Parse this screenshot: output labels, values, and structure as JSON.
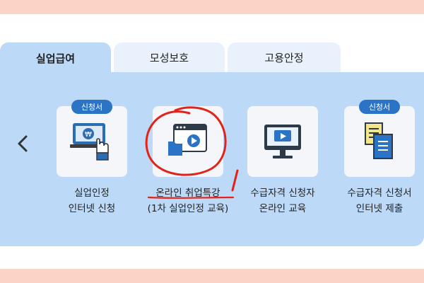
{
  "tabs": [
    {
      "label": "실업급여"
    },
    {
      "label": "모성보호"
    },
    {
      "label": "고용안정"
    }
  ],
  "badges": {
    "application_form": "신청서"
  },
  "services": [
    {
      "line1": "실업인정",
      "line2": "인터넷 신청",
      "icon": "laptop-click-icon"
    },
    {
      "line1": "온라인 취업특강",
      "line2": "(1차 실업인정 교육)",
      "icon": "video-window-icon"
    },
    {
      "line1": "수급자격 신청자",
      "line2": "온라인 교육",
      "icon": "monitor-play-icon"
    },
    {
      "line1": "수급자격 신청서",
      "line2": "인터넷 제출",
      "icon": "documents-icon"
    }
  ],
  "colors": {
    "panel": "#bcd9f7",
    "tab_inactive": "#e8f1fc",
    "badge": "#2a73c5",
    "accent_band": "#fbd3c7",
    "annotation": "#e2231a"
  }
}
